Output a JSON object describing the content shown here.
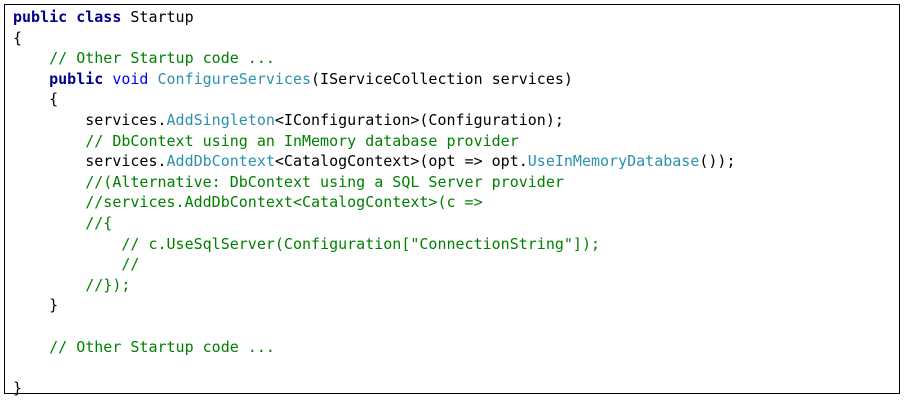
{
  "colors": {
    "keyword": "#00008b",
    "comment": "#008000",
    "method": "#2b91af",
    "text": "#000000"
  },
  "code": {
    "lines": [
      [
        {
          "t": "kw",
          "s": "public class"
        },
        {
          "t": "tx",
          "s": " Startup"
        }
      ],
      [
        {
          "t": "tx",
          "s": "{"
        }
      ],
      [
        {
          "t": "tx",
          "s": "    "
        },
        {
          "t": "cm",
          "s": "// Other Startup code ..."
        }
      ],
      [
        {
          "t": "tx",
          "s": "    "
        },
        {
          "t": "kw",
          "s": "public"
        },
        {
          "t": "kw2",
          "s": " void"
        },
        {
          "t": "tx",
          "s": " "
        },
        {
          "t": "mt",
          "s": "ConfigureServices"
        },
        {
          "t": "tx",
          "s": "(IServiceCollection services)"
        }
      ],
      [
        {
          "t": "tx",
          "s": "    {"
        }
      ],
      [
        {
          "t": "tx",
          "s": "        services."
        },
        {
          "t": "mt",
          "s": "AddSingleton"
        },
        {
          "t": "tx",
          "s": "<IConfiguration>(Configuration);"
        }
      ],
      [
        {
          "t": "tx",
          "s": "        "
        },
        {
          "t": "cm",
          "s": "// DbContext using an InMemory database provider"
        }
      ],
      [
        {
          "t": "tx",
          "s": "        services."
        },
        {
          "t": "mt",
          "s": "AddDbContext"
        },
        {
          "t": "tx",
          "s": "<CatalogContext>(opt => opt."
        },
        {
          "t": "mt",
          "s": "UseInMemoryDatabase"
        },
        {
          "t": "tx",
          "s": "());"
        }
      ],
      [
        {
          "t": "tx",
          "s": "        "
        },
        {
          "t": "cm",
          "s": "//(Alternative: DbContext using a SQL Server provider"
        }
      ],
      [
        {
          "t": "tx",
          "s": "        "
        },
        {
          "t": "cm",
          "s": "//services.AddDbContext<CatalogContext>(c =>"
        }
      ],
      [
        {
          "t": "tx",
          "s": "        "
        },
        {
          "t": "cm",
          "s": "//{"
        }
      ],
      [
        {
          "t": "tx",
          "s": "            "
        },
        {
          "t": "cm",
          "s": "// c.UseSqlServer(Configuration[\"ConnectionString\"]);"
        }
      ],
      [
        {
          "t": "tx",
          "s": "            "
        },
        {
          "t": "cm",
          "s": "//"
        }
      ],
      [
        {
          "t": "tx",
          "s": "        "
        },
        {
          "t": "cm",
          "s": "//});"
        }
      ],
      [
        {
          "t": "tx",
          "s": "    }"
        }
      ],
      [
        {
          "t": "tx",
          "s": ""
        }
      ],
      [
        {
          "t": "tx",
          "s": "    "
        },
        {
          "t": "cm",
          "s": "// Other Startup code ..."
        }
      ],
      [
        {
          "t": "tx",
          "s": ""
        }
      ],
      [
        {
          "t": "tx",
          "s": "}"
        }
      ]
    ]
  }
}
